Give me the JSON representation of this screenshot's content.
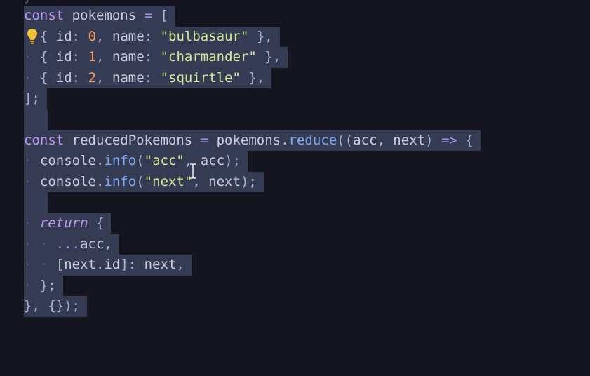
{
  "editor": {
    "partial_top": "}",
    "lines": [
      {
        "indent": "",
        "tokens": [
          [
            "kw",
            "const"
          ],
          [
            "var",
            " pokemons "
          ],
          [
            "op",
            "="
          ],
          [
            "pun",
            " ["
          ]
        ]
      },
      {
        "indent": "",
        "tokens": [
          [
            "pun",
            "{"
          ],
          [
            "var",
            " id"
          ],
          [
            "pun",
            ":"
          ],
          [
            "num",
            " 0"
          ],
          [
            "pun",
            ","
          ],
          [
            "var",
            " name"
          ],
          [
            "pun",
            ":"
          ],
          [
            "str",
            " \"bulbasaur\""
          ],
          [
            "pun",
            " },"
          ]
        ]
      },
      {
        "indent": "· ",
        "tokens": [
          [
            "pun",
            "{"
          ],
          [
            "var",
            " id"
          ],
          [
            "pun",
            ":"
          ],
          [
            "num",
            " 1"
          ],
          [
            "pun",
            ","
          ],
          [
            "var",
            " name"
          ],
          [
            "pun",
            ":"
          ],
          [
            "str",
            " \"charmander\""
          ],
          [
            "pun",
            " },"
          ]
        ]
      },
      {
        "indent": "· ",
        "tokens": [
          [
            "pun",
            "{"
          ],
          [
            "var",
            " id"
          ],
          [
            "pun",
            ":"
          ],
          [
            "num",
            " 2"
          ],
          [
            "pun",
            ","
          ],
          [
            "var",
            " name"
          ],
          [
            "pun",
            ":"
          ],
          [
            "str",
            " \"squirtle\""
          ],
          [
            "pun",
            " },"
          ]
        ]
      },
      {
        "indent": "",
        "tokens": [
          [
            "pun",
            "];"
          ]
        ]
      },
      {
        "indent": "",
        "tokens": []
      },
      {
        "indent": "",
        "tokens": [
          [
            "kw",
            "const"
          ],
          [
            "var",
            " reducedPokemons "
          ],
          [
            "op",
            "="
          ],
          [
            "var",
            " pokemons"
          ],
          [
            "pun",
            "."
          ],
          [
            "fn",
            "reduce"
          ],
          [
            "pun",
            "(("
          ],
          [
            "var",
            "acc"
          ],
          [
            "pun",
            ","
          ],
          [
            "var",
            " next"
          ],
          [
            "pun",
            ")"
          ],
          [
            "op",
            " =>"
          ],
          [
            "pun",
            " {"
          ]
        ]
      },
      {
        "indent": "· ",
        "tokens": [
          [
            "var",
            "console"
          ],
          [
            "pun",
            "."
          ],
          [
            "fn",
            "info"
          ],
          [
            "pun",
            "("
          ],
          [
            "str",
            "\"acc\""
          ],
          [
            "pun",
            ","
          ],
          [
            "var",
            " acc"
          ],
          [
            "pun",
            ");"
          ]
        ]
      },
      {
        "indent": "· ",
        "tokens": [
          [
            "var",
            "console"
          ],
          [
            "pun",
            "."
          ],
          [
            "fn",
            "info"
          ],
          [
            "pun",
            "("
          ],
          [
            "str",
            "\"next\""
          ],
          [
            "pun",
            ","
          ],
          [
            "var",
            " next"
          ],
          [
            "pun",
            ");"
          ]
        ]
      },
      {
        "indent": "",
        "tokens": []
      },
      {
        "indent": "· ",
        "tokens": [
          [
            "kw-i",
            "return"
          ],
          [
            "pun",
            " {"
          ]
        ]
      },
      {
        "indent": "· · ",
        "tokens": [
          [
            "op",
            "..."
          ],
          [
            "var",
            "acc"
          ],
          [
            "pun",
            ","
          ]
        ]
      },
      {
        "indent": "· · ",
        "tokens": [
          [
            "pun",
            "["
          ],
          [
            "var",
            "next"
          ],
          [
            "pun",
            "."
          ],
          [
            "var",
            "id"
          ],
          [
            "pun",
            "]:"
          ],
          [
            "var",
            " next"
          ],
          [
            "pun",
            ","
          ]
        ]
      },
      {
        "indent": "· ",
        "tokens": [
          [
            "pun",
            "};"
          ]
        ]
      },
      {
        "indent": "",
        "tokens": [
          [
            "pun",
            "},"
          ],
          [
            "pun",
            " {});"
          ]
        ]
      }
    ]
  },
  "icons": {
    "lightbulb": "lightbulb-icon",
    "text_cursor": "text-cursor-icon"
  },
  "colors": {
    "background": "#14151e",
    "selection": "#353b53",
    "keyword": "#c09cf5",
    "function": "#7ea9f5",
    "string": "#d3e998",
    "number": "#ff9e64",
    "lightbulb": "#f2c13a"
  }
}
